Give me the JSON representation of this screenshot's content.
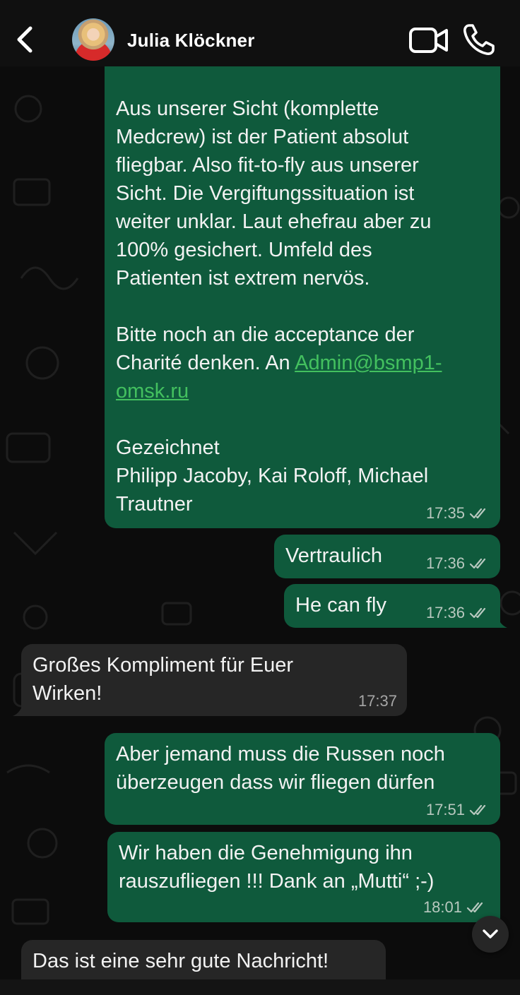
{
  "header": {
    "contact_name": "Julia Klöckner",
    "back_icon": "chevron-left-icon",
    "video_icon": "video-camera-icon",
    "call_icon": "phone-icon"
  },
  "messages": [
    {
      "direction": "outgoing",
      "text_part1": "Aus unserer Sicht (komplette\nMedcrew) ist der Patient absolut\nfliegbar. Also fit-to-fly aus unserer\nSicht. Die Vergiftungssituation ist\nweiter unklar. Laut ehefrau aber zu\n100% gesichert. Umfeld des\nPatienten ist extrem nervös.\n\nBitte noch an die acceptance der\nCharité denken. An ",
      "link": "Admin@bsmp1-\nomsk.ru",
      "text_part2": "\n\nGezeichnet\nPhilipp Jacoby, Kai Roloff, Michael\nTrautner",
      "time": "17:35",
      "status": "read"
    },
    {
      "direction": "outgoing",
      "text": "Vertraulich",
      "time": "17:36",
      "status": "read"
    },
    {
      "direction": "outgoing",
      "text": "He can fly",
      "time": "17:36",
      "status": "read"
    },
    {
      "direction": "incoming",
      "text": "Großes Kompliment für Euer\nWirken!",
      "time": "17:37"
    },
    {
      "direction": "outgoing",
      "text": "Aber jemand muss die Russen noch\nüberzeugen dass wir fliegen dürfen",
      "time": "17:51",
      "status": "read"
    },
    {
      "direction": "outgoing",
      "text": "Wir haben die Genehmigung ihn\nrauszufliegen !!! Dank an „Mutti“ ;-)",
      "time": "18:01",
      "status": "read"
    },
    {
      "direction": "incoming",
      "text": "Das ist eine sehr gute Nachricht!"
    }
  ],
  "colors": {
    "outgoing_bubble": "#0f5a3c",
    "incoming_bubble": "#262626",
    "link": "#43c05f",
    "background": "#0c0c0c"
  },
  "scroll_down_icon": "chevron-down-icon"
}
